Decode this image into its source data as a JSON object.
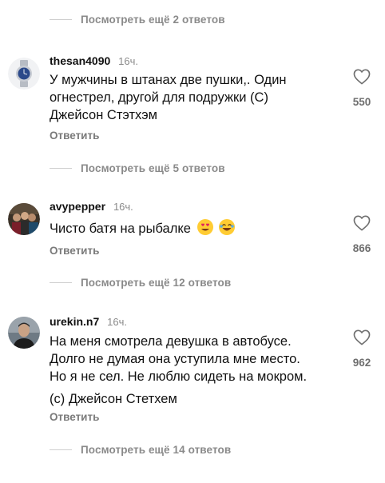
{
  "view_more": [
    {
      "label": "Посмотреть ещё 2 ответов"
    },
    {
      "label": "Посмотреть ещё 5 ответов"
    },
    {
      "label": "Посмотреть ещё 12 ответов"
    },
    {
      "label": "Посмотреть ещё 14 ответов"
    }
  ],
  "comments": [
    {
      "username": "thesan4090",
      "time": "16ч.",
      "lines": [
        "У мужчины в штанах две пушки,. Один",
        "огнестрел, другой для подружки (С)",
        "Джейсон Стэтхэм"
      ],
      "reply_label": "Ответить",
      "likes": "550",
      "avatar": "watch-avatar"
    },
    {
      "username": "avypepper",
      "time": "16ч.",
      "lines": [
        "Чисто батя на рыбалке"
      ],
      "emojis": [
        "heart-eyes-emoji",
        "laughing-emoji"
      ],
      "reply_label": "Ответить",
      "likes": "866",
      "avatar": "group-photo-avatar"
    },
    {
      "username": "urekin.n7",
      "time": "16ч.",
      "lines": [
        "На меня смотрела девушка в автобусе.",
        "Долго не думая она уступила мне место.",
        "Но я не сел. Не люблю сидеть на мокром.",
        "(с) Джейсон Стетхем"
      ],
      "reply_label": "Ответить",
      "likes": "962",
      "avatar": "man-portrait-avatar"
    }
  ],
  "colors": {
    "text": "#111111",
    "muted": "#8a8a8a",
    "divider": "#cfcfcf"
  }
}
